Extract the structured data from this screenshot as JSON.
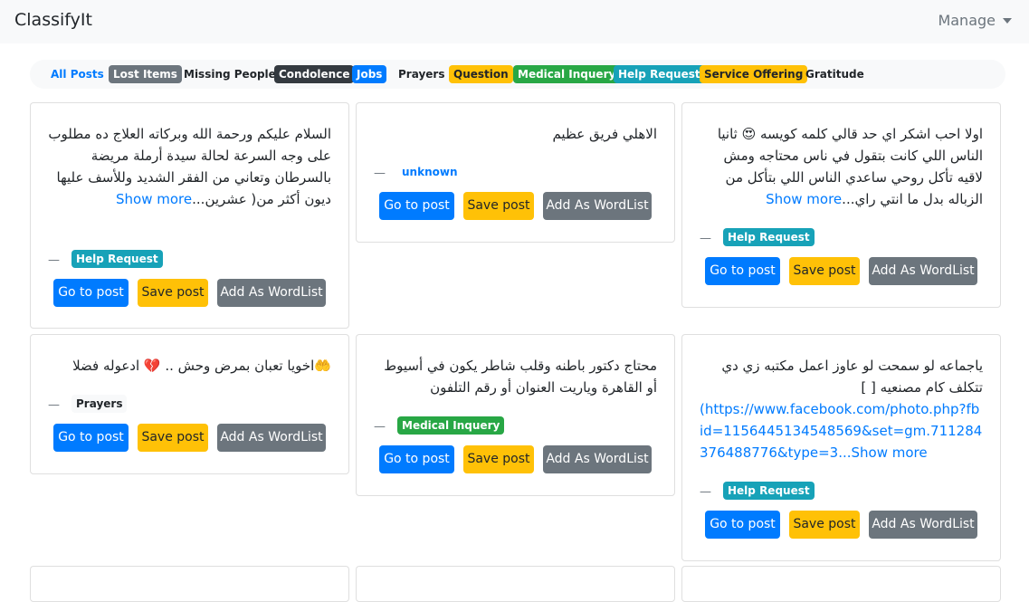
{
  "navbar": {
    "brand": "ClassifyIt",
    "manage_label": "Manage"
  },
  "filters": [
    {
      "label": "All Posts",
      "style": "link"
    },
    {
      "label": "Lost Items",
      "style": "secondary",
      "color": "#6c757d"
    },
    {
      "label": "Missing People",
      "style": "light"
    },
    {
      "label": "Condolence",
      "style": "dark",
      "color": "#343a40"
    },
    {
      "label": "Jobs",
      "style": "primary",
      "color": "#007bff"
    },
    {
      "label": "Prayers",
      "style": "light"
    },
    {
      "label": "Question",
      "style": "warning",
      "color": "#ffc107"
    },
    {
      "label": "Medical Inquery",
      "style": "success",
      "color": "#28a745"
    },
    {
      "label": "Help Request",
      "style": "info",
      "color": "#17a2b8"
    },
    {
      "label": "Service Offering",
      "style": "warning",
      "color": "#ffc107"
    },
    {
      "label": "Gratitude",
      "style": "light"
    }
  ],
  "buttons": {
    "go": "Go to post",
    "save": "Save post",
    "wordlist": "Add As WordList"
  },
  "show_more": "Show more",
  "dash": "—",
  "posts": [
    {
      "text": "السلام عليكم ورحمة الله وبركاته العلاج ده مطلوب على وجه السرعة لحالة سيدة أرملة مريضة بالسرطان وتعاني من الفقر الشديد وللأسف عليها ديون أكثر من( عشرين...",
      "show_more": "Show more",
      "category": "Help Request"
    },
    {
      "text": "الاهلي فريق عظيم",
      "category": "unknown"
    },
    {
      "text": "اولا احب اشكر اي حد قالي كلمه كويسه 😍 ثانيا الناس اللي كانت بتقول في ناس محتاجه ومش لاقيه تأكل روحي ساعدي الناس اللي بتأكل من الزباله بدل ما انتي راي...",
      "show_more": "Show more",
      "category": "Help Request"
    },
    {
      "text": "🤲اخويا تعبان بمرض وحش .. 💔 ادعوله فضلا",
      "category": "Prayers"
    },
    {
      "text": "محتاج دكتور باطنه وقلب شاطر يكون في أسيوط أو القاهرة وياريت العنوان أو رقم التلفون",
      "category": "Medical Inquery"
    },
    {
      "text": "ياجماعه لو سمحت لو عاوز اعمل مكتبه زي دي تتكلف كام مصنعيه [ ]",
      "link": "(https://www.facebook.com/photo.php?fbid=1156445134548569&set=gm.711284376488776&type=3...",
      "show_more": "Show more",
      "category": "Help Request"
    }
  ]
}
